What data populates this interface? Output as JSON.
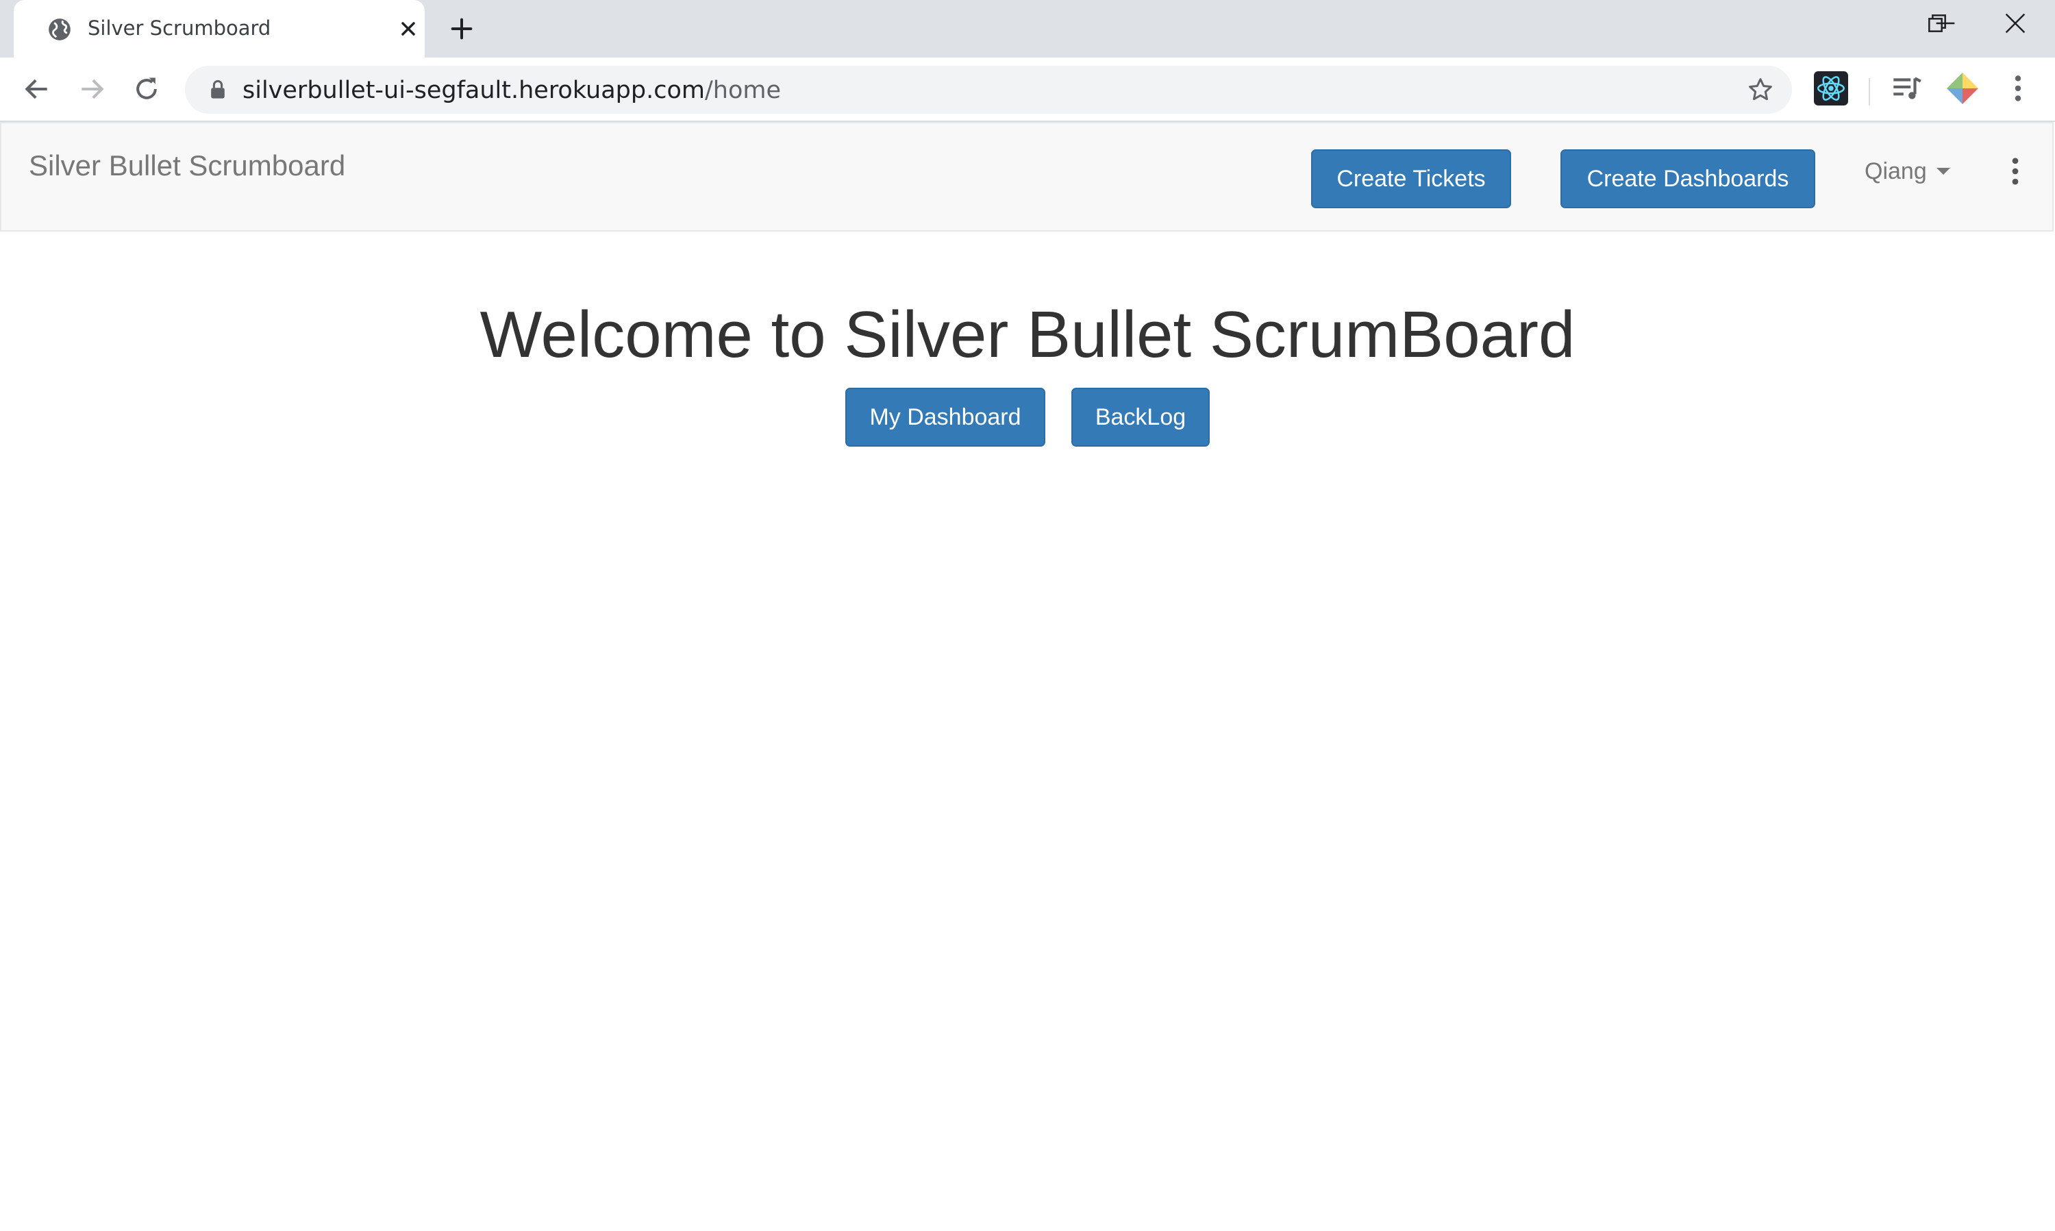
{
  "browser": {
    "tab": {
      "title": "Silver Scrumboard",
      "favicon_icon": "globe-icon",
      "close_icon": "close-icon"
    },
    "new_tab_icon": "plus-icon",
    "window_controls": [
      "minimize-icon",
      "restore-icon",
      "close-icon"
    ],
    "toolbar": {
      "back_icon": "arrow-left-icon",
      "forward_icon": "arrow-right-icon",
      "reload_icon": "reload-icon",
      "url_host": "silverbullet-ui-segfault.herokuapp.com",
      "url_path": "/home",
      "bookmark_icon": "star-icon",
      "extensions": [
        "react-devtools-icon",
        "media-queue-icon",
        "extension-diamond-icon"
      ],
      "menu_icon": "kebab-menu-icon"
    }
  },
  "navbar": {
    "brand": "Silver Bullet Scrumboard",
    "create_tickets_label": "Create Tickets",
    "create_dashboards_label": "Create Dashboards",
    "user_name": "Qiang",
    "more_icon": "kebab-menu-icon"
  },
  "main": {
    "heading": "Welcome to Silver Bullet ScrumBoard",
    "my_dashboard_label": "My Dashboard",
    "backlog_label": "BackLog"
  },
  "colors": {
    "primary": "#337ab7",
    "primary_border": "#2e6da4",
    "navbar_bg": "#f8f8f8",
    "tabstrip_bg": "#dee1e6"
  }
}
